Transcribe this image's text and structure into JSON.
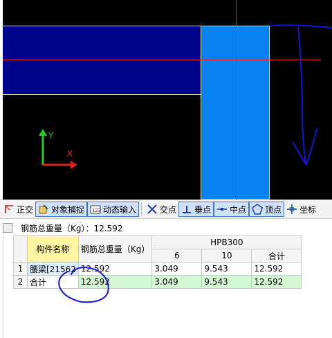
{
  "canvas": {
    "axis_y_label": "Y",
    "axis_x_label": "X"
  },
  "toolbar": {
    "ortho_label": "正交",
    "snap_label": "对象捕捉",
    "dynamic_input_label": "动态输入",
    "intersection_label": "交点",
    "perpendicular_label": "垂点",
    "midpoint_label": "中点",
    "vertex_label": "顶点",
    "coordinate_label": "坐标"
  },
  "panel": {
    "title": "钢筋总重量（Kg）：12.592"
  },
  "table": {
    "headers": {
      "component_name": "构件名称",
      "total_weight": "钢筋总重量（Kg）",
      "grade": "HPB300",
      "sub": [
        "6",
        "10",
        "合计"
      ]
    },
    "rows": [
      {
        "num": "1",
        "name": "腰梁[21562",
        "total": "12.592",
        "d6": "3.049",
        "d10": "9.543",
        "sum": "12.592"
      },
      {
        "num": "2",
        "name": "合计",
        "total": "12.592",
        "d6": "3.049",
        "d10": "9.543",
        "sum": "12.592"
      }
    ]
  },
  "colors": {
    "beam": "#00048a",
    "column": "#0a82f0",
    "guide_line": "#e0292b",
    "annotation_pen": "#1515d8",
    "header_highlight": "#fff6a3",
    "sum_row": "#d4f7d4"
  }
}
